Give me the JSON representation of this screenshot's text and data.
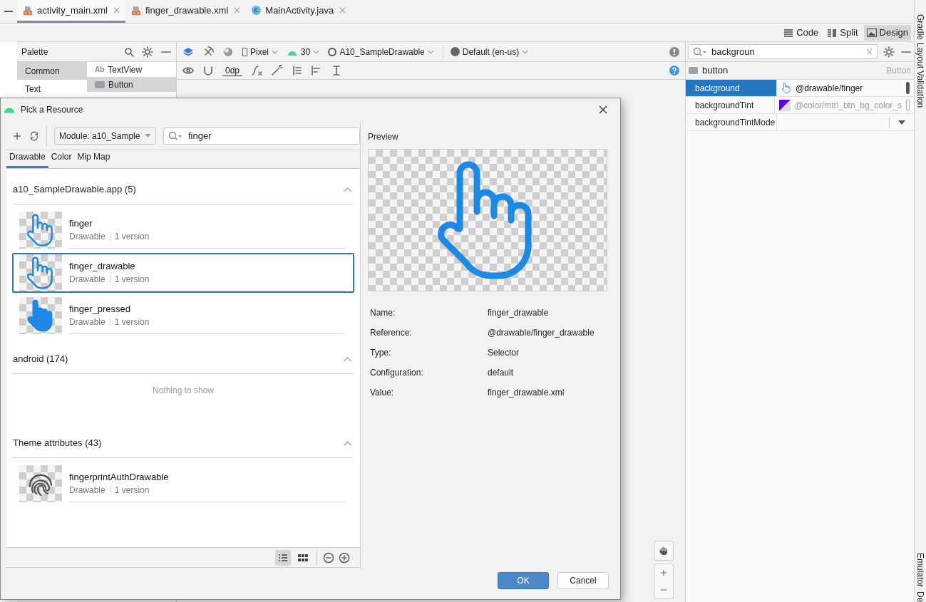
{
  "editor_tabs": [
    {
      "label": "activity_main.xml",
      "kind": "xml",
      "selected": true
    },
    {
      "label": "finger_drawable.xml",
      "kind": "xml",
      "selected": false
    },
    {
      "label": "MainActivity.java",
      "kind": "java",
      "selected": false
    }
  ],
  "view_modes": [
    {
      "label": "Code",
      "kind": "code",
      "selected": false
    },
    {
      "label": "Split",
      "kind": "split",
      "selected": false
    },
    {
      "label": "Design",
      "kind": "design",
      "selected": true
    }
  ],
  "palette": {
    "title": "Palette",
    "categories": [
      {
        "label": "Common",
        "selected": true
      },
      {
        "label": "Text",
        "selected": false
      }
    ],
    "items": [
      {
        "label": "TextView",
        "kind": "text",
        "icon_text": "Ab",
        "selected": false
      },
      {
        "label": "Button",
        "kind": "button",
        "selected": true
      }
    ]
  },
  "design_toolbar": {
    "device": "Pixel",
    "api": "30",
    "theme": "A10_SampleDrawable",
    "locale": "Default (en-us)",
    "margin": "0dp"
  },
  "attributes": {
    "search": "backgroun",
    "component": "button",
    "component_type": "Button",
    "rows": [
      {
        "name": "background",
        "value": "@drawable/finger",
        "kind": "drawable",
        "selected": true
      },
      {
        "name": "backgroundTint",
        "value": "@color/mtrl_btn_bg_color_s",
        "kind": "color",
        "selected": false
      },
      {
        "name": "backgroundTintMode",
        "kind": "dropdown",
        "selected": false
      }
    ]
  },
  "side_tools_top": [
    "Gradle",
    "Layout Validation"
  ],
  "side_tools_bottom": [
    "Emulator",
    "De"
  ],
  "dialog": {
    "title": "Pick a Resource",
    "module": "Module: a10_Sample",
    "search": "finger",
    "tabs": [
      {
        "label": "Drawable",
        "selected": true
      },
      {
        "label": "Color",
        "selected": false
      },
      {
        "label": "Mip Map",
        "selected": false
      }
    ],
    "sections": [
      {
        "title": "a10_SampleDrawable.app (5)",
        "expanded": true,
        "items": [
          {
            "name": "finger",
            "type": "Drawable",
            "versions": "1 version",
            "kind": "outline",
            "selected": false
          },
          {
            "name": "finger_drawable",
            "type": "Drawable",
            "versions": "1 version",
            "kind": "outline",
            "selected": true
          },
          {
            "name": "finger_pressed",
            "type": "Drawable",
            "versions": "1 version",
            "kind": "filled",
            "selected": false
          }
        ]
      },
      {
        "title": "android (174)",
        "expanded": true,
        "empty_text": "Nothing to show"
      },
      {
        "title": "Theme attributes (43)",
        "expanded": true,
        "items": [
          {
            "name": "fingerprintAuthDrawable",
            "type": "Drawable",
            "versions": "1 version",
            "kind": "fingerprint",
            "selected": false
          }
        ]
      }
    ],
    "view_modes": [
      {
        "kind": "list",
        "selected": true
      },
      {
        "kind": "grid",
        "selected": false
      }
    ],
    "preview": {
      "title": "Preview",
      "fields": [
        {
          "label": "Name:",
          "value": "finger_drawable"
        },
        {
          "label": "Reference:",
          "value": "@drawable/finger_drawable"
        },
        {
          "label": "Type:",
          "value": "Selector"
        },
        {
          "label": "Configuration:",
          "value": "default"
        },
        {
          "label": "Value:",
          "value": "finger_drawable.xml"
        }
      ]
    },
    "buttons": [
      {
        "label": "OK",
        "primary": true
      },
      {
        "label": "Cancel",
        "primary": false
      }
    ]
  }
}
